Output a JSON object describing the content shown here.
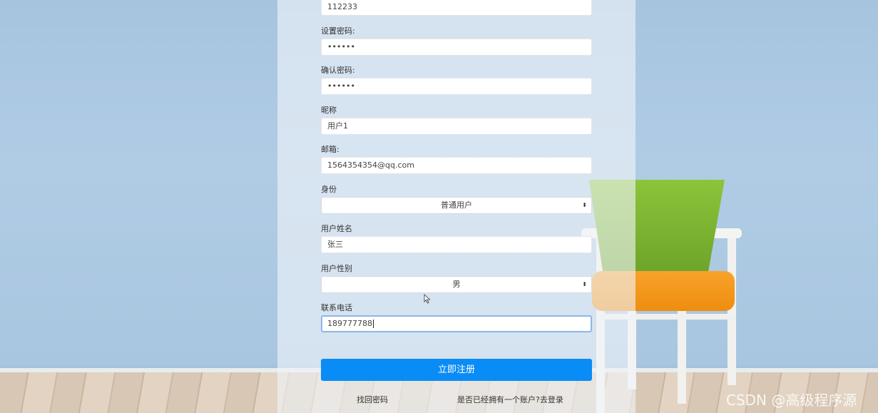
{
  "form": {
    "account": {
      "value": "112233"
    },
    "password": {
      "label": "设置密码:",
      "value": "••••••"
    },
    "confirm_password": {
      "label": "确认密码:",
      "value": "••••••"
    },
    "nickname": {
      "label": "昵称",
      "value": "用户1"
    },
    "email": {
      "label": "邮箱:",
      "value": "1564354354@qq.com"
    },
    "identity": {
      "label": "身份",
      "selected": "普通用户"
    },
    "real_name": {
      "label": "用户姓名",
      "value": "张三"
    },
    "gender": {
      "label": "用户性别",
      "selected": "男"
    },
    "phone": {
      "label": "联系电话",
      "value": "189777788"
    },
    "submit_label": "立即注册"
  },
  "links": {
    "find_password": "找回密码",
    "go_login": "是否已经拥有一个账户?去登录"
  },
  "watermark": "CSDN @高级程序源",
  "colors": {
    "primary": "#0a8cf6",
    "focus_border": "#8eb6e8"
  }
}
